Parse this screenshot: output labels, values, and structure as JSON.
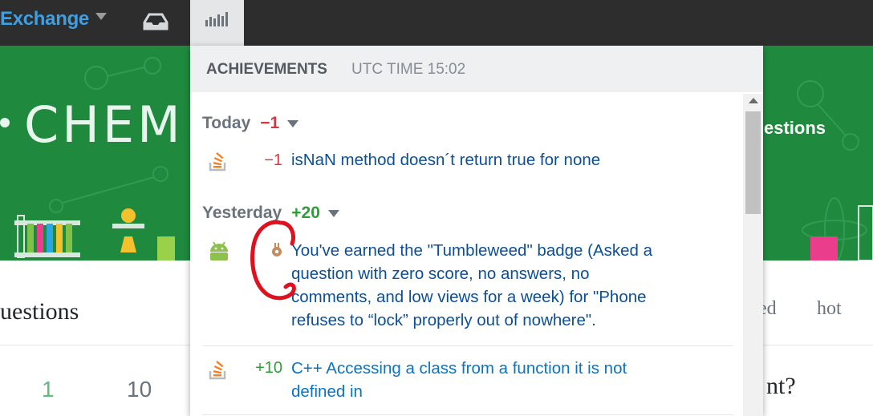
{
  "topbar": {
    "brand": "Exchange",
    "inbox_icon": "inbox-icon",
    "achievements_icon": "achievements-icon"
  },
  "banner": {
    "title": "CHEM",
    "questions_label": "estions"
  },
  "page": {
    "heading": "uestions",
    "sort_tabs": [
      "ed",
      "hot"
    ],
    "votes": "1",
    "answers": "10",
    "side_text": "nt?"
  },
  "achievements": {
    "title": "ACHIEVEMENTS",
    "utc_time": "UTC TIME 15:02",
    "groups": [
      {
        "label": "Today",
        "delta": "−1",
        "items": [
          {
            "icon": "stackoverflow-icon",
            "delta": "−1",
            "text": "isNaN method doesn´t return true for none"
          }
        ]
      },
      {
        "label": "Yesterday",
        "delta": "+20",
        "items": [
          {
            "icon": "android-icon",
            "badge_icon": "bronze-badge-icon",
            "delta": "",
            "text_lines": [
              "You've earned the \"Tumbleweed\" badge (Asked a",
              "question with zero score, no answers, no",
              "comments, and low views for a week) for \"Phone",
              "refuses to “lock” properly out of nowhere\"."
            ]
          },
          {
            "icon": "stackoverflow-icon",
            "delta": "+10",
            "text_lines": [
              "C++ Accessing a class from a function it is not",
              "defined in"
            ]
          }
        ]
      }
    ]
  },
  "colors": {
    "banner_green": "#1f8a3e",
    "topbar": "#2d2d2d",
    "brand_blue": "#3ea0e4",
    "negative": "#d0393e",
    "positive": "#2f9e3a",
    "link": "#0c4f96",
    "annotation_red": "#e0101e"
  }
}
